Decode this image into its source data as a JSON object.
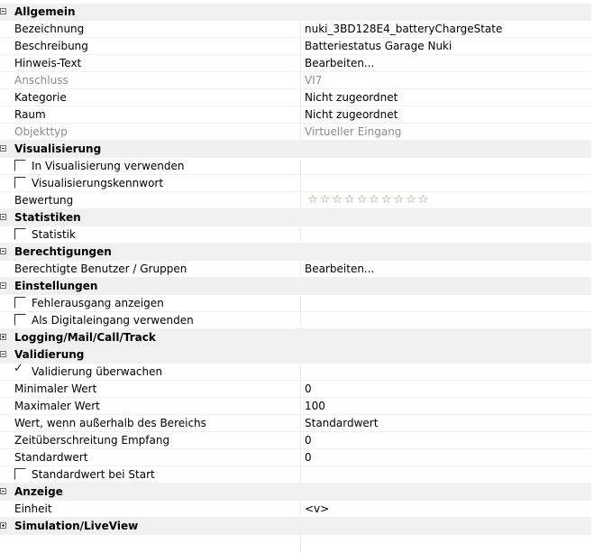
{
  "categories": {
    "allgemein": "Allgemein",
    "visualisierung": "Visualisierung",
    "statistiken": "Statistiken",
    "berechtigungen": "Berechtigungen",
    "einstellungen": "Einstellungen",
    "logging": "Logging/Mail/Call/Track",
    "validierung": "Validierung",
    "anzeige": "Anzeige",
    "simulation": "Simulation/LiveView"
  },
  "allgemein": {
    "bezeichnung": {
      "name": "Bezeichnung",
      "value": "nuki_3BD128E4_batteryChargeState"
    },
    "beschreibung": {
      "name": "Beschreibung",
      "value": "Batteriestatus Garage Nuki"
    },
    "hinweis": {
      "name": "Hinweis-Text",
      "value": "Bearbeiten..."
    },
    "anschluss": {
      "name": "Anschluss",
      "value": "VI7"
    },
    "kategorie": {
      "name": "Kategorie",
      "value": "Nicht zugeordnet"
    },
    "raum": {
      "name": "Raum",
      "value": "Nicht zugeordnet"
    },
    "objekttyp": {
      "name": "Objekttyp",
      "value": "Virtueller Eingang"
    }
  },
  "visualisierung": {
    "in_vis": {
      "name": "In Visualisierung verwenden",
      "checked": false
    },
    "kennwort": {
      "name": "Visualisierungskennwort",
      "checked": false
    },
    "bewertung": {
      "name": "Bewertung",
      "rating": 0,
      "max": 10
    }
  },
  "statistiken": {
    "statistik": {
      "name": "Statistik",
      "checked": false
    }
  },
  "berechtigungen": {
    "benutzer": {
      "name": "Berechtigte Benutzer / Gruppen",
      "value": "Bearbeiten..."
    }
  },
  "einstellungen": {
    "fehlerausgang": {
      "name": "Fehlerausgang anzeigen",
      "checked": false
    },
    "digitaleingang": {
      "name": "Als Digitaleingang verwenden",
      "checked": false
    }
  },
  "validierung": {
    "ueberwachen": {
      "name": "Validierung überwachen",
      "checked": true
    },
    "min": {
      "name": "Minimaler Wert",
      "value": "0"
    },
    "max": {
      "name": "Maximaler Wert",
      "value": "100"
    },
    "ausserhalb": {
      "name": "Wert, wenn außerhalb des Bereichs",
      "value": "Standardwert"
    },
    "zeit": {
      "name": "Zeitüberschreitung Empfang",
      "value": "0"
    },
    "standard": {
      "name": "Standardwert",
      "value": "0"
    },
    "standard_start": {
      "name": "Standardwert bei Start",
      "checked": false
    }
  },
  "anzeige": {
    "einheit": {
      "name": "Einheit",
      "value": "<v>"
    }
  },
  "icons": {
    "expanded": "minus-box",
    "collapsed": "plus-box",
    "check": "✓",
    "star": "☆"
  },
  "colors": {
    "category_bg": "#f0f0f0",
    "disabled_text": "#8c8c8c",
    "grid_line": "#f0f0f0"
  }
}
